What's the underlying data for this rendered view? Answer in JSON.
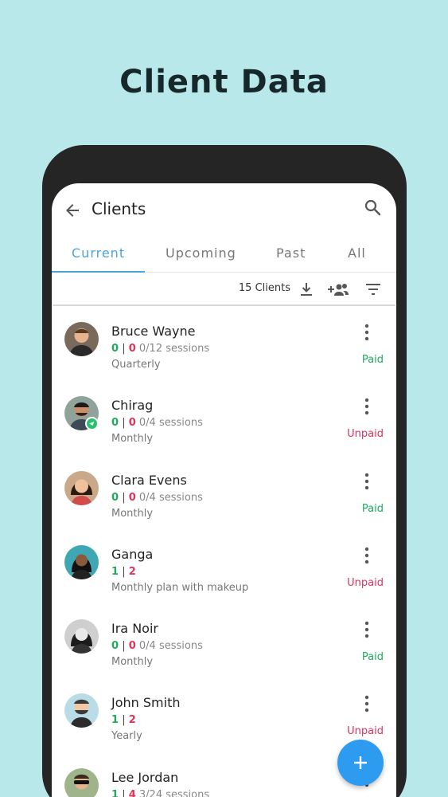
{
  "headline": "Client Data",
  "appbar": {
    "title": "Clients"
  },
  "tabs": [
    {
      "label": "Current",
      "active": true
    },
    {
      "label": "Upcoming",
      "active": false
    },
    {
      "label": "Past",
      "active": false
    },
    {
      "label": "All",
      "active": false
    }
  ],
  "toolbar": {
    "count": "15 Clients",
    "icons": [
      "download-icon",
      "add-group-icon",
      "filter-icon"
    ]
  },
  "colors": {
    "accent": "#4aa3db",
    "paid": "#1faa5c",
    "unpaid": "#e0335a",
    "fab": "#2c9bf0",
    "background": "#b9e8ea"
  },
  "clients": [
    {
      "name": "Bruce Wayne",
      "done": "0",
      "missed": "0",
      "sessions": "0/12 sessions",
      "plan": "Quarterly",
      "status": "Paid"
    },
    {
      "name": "Chirag",
      "done": "0",
      "missed": "0",
      "sessions": "0/4 sessions",
      "plan": "Monthly",
      "status": "Unpaid"
    },
    {
      "name": "Clara Evens",
      "done": "0",
      "missed": "0",
      "sessions": "0/4 sessions",
      "plan": "Monthly",
      "status": "Paid"
    },
    {
      "name": "Ganga",
      "done": "1",
      "missed": "2",
      "sessions": "",
      "plan": "Monthly plan with makeup",
      "status": "Unpaid"
    },
    {
      "name": "Ira Noir",
      "done": "0",
      "missed": "0",
      "sessions": "0/4 sessions",
      "plan": "Monthly",
      "status": "Paid"
    },
    {
      "name": "John Smith",
      "done": "1",
      "missed": "2",
      "sessions": "",
      "plan": "Yearly",
      "status": "Unpaid"
    },
    {
      "name": "Lee Jordan",
      "done": "1",
      "missed": "4",
      "sessions": "3/24 sessions",
      "plan": "",
      "status": ""
    }
  ]
}
